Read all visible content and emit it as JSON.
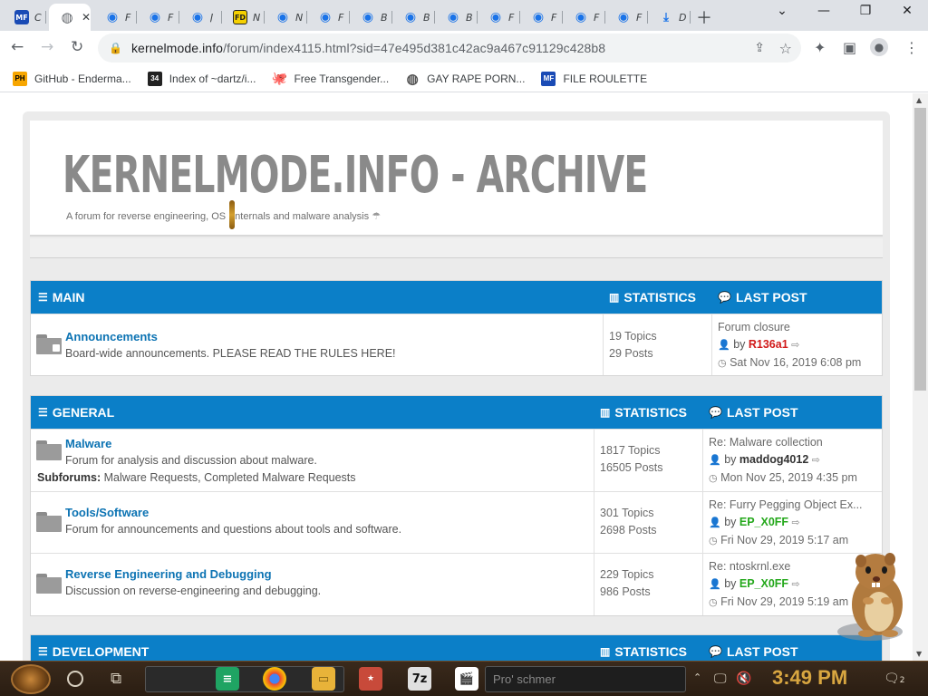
{
  "browser": {
    "tabs": [
      {
        "icon": "MF",
        "label": "C",
        "kind": "mf"
      },
      {
        "icon": "globe",
        "label": "",
        "kind": "globe",
        "active": true
      },
      {
        "icon": "eye",
        "label": "F",
        "kind": "eye"
      },
      {
        "icon": "eye",
        "label": "F",
        "kind": "eye"
      },
      {
        "icon": "eye",
        "label": "J",
        "kind": "eye"
      },
      {
        "icon": "FD",
        "label": "N",
        "kind": "fd"
      },
      {
        "icon": "eye",
        "label": "N",
        "kind": "eye"
      },
      {
        "icon": "eye",
        "label": "F",
        "kind": "eye"
      },
      {
        "icon": "eye",
        "label": "B",
        "kind": "eye"
      },
      {
        "icon": "eye",
        "label": "B",
        "kind": "eye"
      },
      {
        "icon": "eye",
        "label": "B",
        "kind": "eye"
      },
      {
        "icon": "eye",
        "label": "F",
        "kind": "eye"
      },
      {
        "icon": "eye",
        "label": "F",
        "kind": "eye"
      },
      {
        "icon": "eye",
        "label": "F",
        "kind": "eye"
      },
      {
        "icon": "eye",
        "label": "F",
        "kind": "eye"
      },
      {
        "icon": "download",
        "label": "D",
        "kind": "dl"
      }
    ],
    "url_host": "kernelmode.info",
    "url_path": "/forum/index4115.html?sid=47e495d381c42ac9a467c91129c428b8",
    "bookmarks": [
      {
        "icon": "PH",
        "kind": "ph",
        "label": "GitHub - Enderma..."
      },
      {
        "icon": "34",
        "kind": "idx",
        "label": "Index of ~dartz/i..."
      },
      {
        "icon": "gh",
        "kind": "gh",
        "label": "Free Transgender..."
      },
      {
        "icon": "globe",
        "kind": "glb",
        "label": "GAY RAPE PORN..."
      },
      {
        "icon": "MF",
        "kind": "mf2",
        "label": "FILE ROULETTE"
      }
    ]
  },
  "site": {
    "title": "KERNELMODE.INFO - ARCHIVE",
    "description": "A forum for reverse engineering, OS internals and malware analysis",
    "description_prefix": "A forum for reverse engineering, OS ",
    "description_suffix": "nternals and malware analysis"
  },
  "sections": [
    {
      "name": "MAIN",
      "stats_header": "STATISTICS",
      "last_header": "LAST POST",
      "forums": [
        {
          "name": "Announcements",
          "description": "Board-wide announcements. PLEASE READ THE RULES HERE!",
          "topics": "19 Topics",
          "posts": "29 Posts",
          "last_title": "Forum closure",
          "last_user": "R136a1",
          "last_user_color": "red",
          "last_time": "Sat Nov 16, 2019 6:08 pm",
          "locked": true
        }
      ]
    },
    {
      "name": "GENERAL",
      "stats_header": "STATISTICS",
      "last_header": "LAST POST",
      "forums": [
        {
          "name": "Malware",
          "description": "Forum for analysis and discussion about malware.",
          "subforums_label": "Subforums:",
          "subforums": "Malware Requests, Completed Malware Requests",
          "topics": "1817 Topics",
          "posts": "16505 Posts",
          "last_title": "Re: Malware collection",
          "last_user": "maddog4012",
          "last_user_color": "dark",
          "last_time": "Mon Nov 25, 2019 4:35 pm"
        },
        {
          "name": "Tools/Software",
          "description": "Forum for announcements and questions about tools and software.",
          "topics": "301 Topics",
          "posts": "2698 Posts",
          "last_title": "Re: Furry Pegging Object Ex...",
          "last_user": "EP_X0FF",
          "last_user_color": "green",
          "last_time": "Fri Nov 29, 2019 5:17 am"
        },
        {
          "name": "Reverse Engineering and Debugging",
          "description": "Discussion on reverse-engineering and debugging.",
          "topics": "229 Topics",
          "posts": "986 Posts",
          "last_title": "Re: ntoskrnl.exe",
          "last_user": "EP_X0FF",
          "last_user_color": "green",
          "last_time": "Fri Nov 29, 2019 5:19 am"
        }
      ]
    },
    {
      "name": "DEVELOPMENT",
      "stats_header": "STATISTICS",
      "last_header": "LAST POST",
      "forums": []
    }
  ],
  "labels": {
    "by": "by"
  },
  "taskbar": {
    "search_placeholder": "Pro' schmer",
    "clock": "3:49 PM",
    "notification_count": "2"
  },
  "colors": {
    "header_blue": "#0b7fc8",
    "link_blue": "#0c73b3",
    "user_red": "#d11a1a",
    "user_green": "#24a81b",
    "clock_gold": "#d8a640"
  }
}
